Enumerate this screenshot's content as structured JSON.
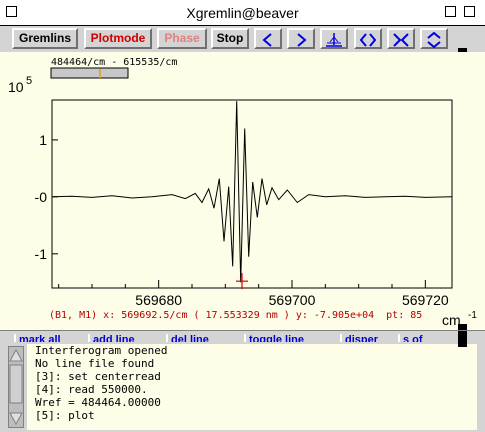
{
  "window": {
    "title": "Xgremlin@beaver"
  },
  "toolbar": {
    "gremlins_label": "Gremlins",
    "plotmode_label": "Plotmode",
    "phase_label": "Phase",
    "stop_label": "Stop",
    "plotmode_color": "#d00000",
    "phase_color": "#e08080",
    "icon_color": "#0000e0",
    "icons": [
      "arrow-left-icon",
      "arrow-right-icon",
      "center-line-icon",
      "expand-horizontal-icon",
      "contract-horizontal-icon",
      "expand-vertical-icon"
    ]
  },
  "plot": {
    "range_label": "484464/cm - 615535/cm",
    "exponent_base": "10",
    "exponent_power": "5",
    "y_ticks": [
      "1",
      "0",
      "-1"
    ],
    "x_ticks": [
      "569680",
      "569700",
      "569720"
    ],
    "x_unit": "cm",
    "x_unit_power": "-1",
    "background_color": "#fdfde8",
    "status": "(B1, M1) x: 569692.5/cm ( 17.553329 nm ) y: -7.905e+04  pt: 85",
    "status_color": "#b40000"
  },
  "chart_data": {
    "type": "line",
    "xlabel": "cm-1",
    "ylabel": "",
    "ylim": [
      -1.6,
      1.7
    ],
    "xlim": [
      569664,
      569724
    ],
    "marker": {
      "x": 569692.5,
      "y": -1.48
    },
    "x": [
      569664,
      569667,
      569670,
      569673,
      569676,
      569679,
      569682,
      569684,
      569685.5,
      569686.5,
      569687.5,
      569688.3,
      569689.1,
      569689.8,
      569690.5,
      569691.1,
      569691.7,
      569692.3,
      569692.9,
      569693.5,
      569694.1,
      569694.8,
      569695.5,
      569696.2,
      569697,
      569698,
      569699.3,
      569700.8,
      569702.5,
      569705,
      569708,
      569711,
      569714,
      569717,
      569720,
      569724
    ],
    "y": [
      0.0,
      0.01,
      -0.01,
      0.02,
      -0.02,
      0.0,
      0.04,
      -0.03,
      0.06,
      -0.1,
      0.14,
      -0.2,
      0.32,
      -0.78,
      0.18,
      -1.22,
      1.68,
      -1.5,
      1.2,
      -1.05,
      0.26,
      -0.36,
      0.32,
      -0.14,
      0.16,
      -0.05,
      0.12,
      -0.1,
      0.04,
      0.0,
      0.02,
      -0.01,
      0.0,
      0.01,
      -0.01,
      0.0
    ]
  },
  "toolbar2": {
    "buttons": [
      "mark all",
      "add line",
      "del line",
      "toggle line",
      "disper",
      "s  of"
    ]
  },
  "log": {
    "lines": [
      "Interferogram opened",
      "No line file found",
      "[3]: set centerread",
      "[4]: read 550000.",
      "Wref = 484464.00000",
      "[5]: plot"
    ]
  }
}
